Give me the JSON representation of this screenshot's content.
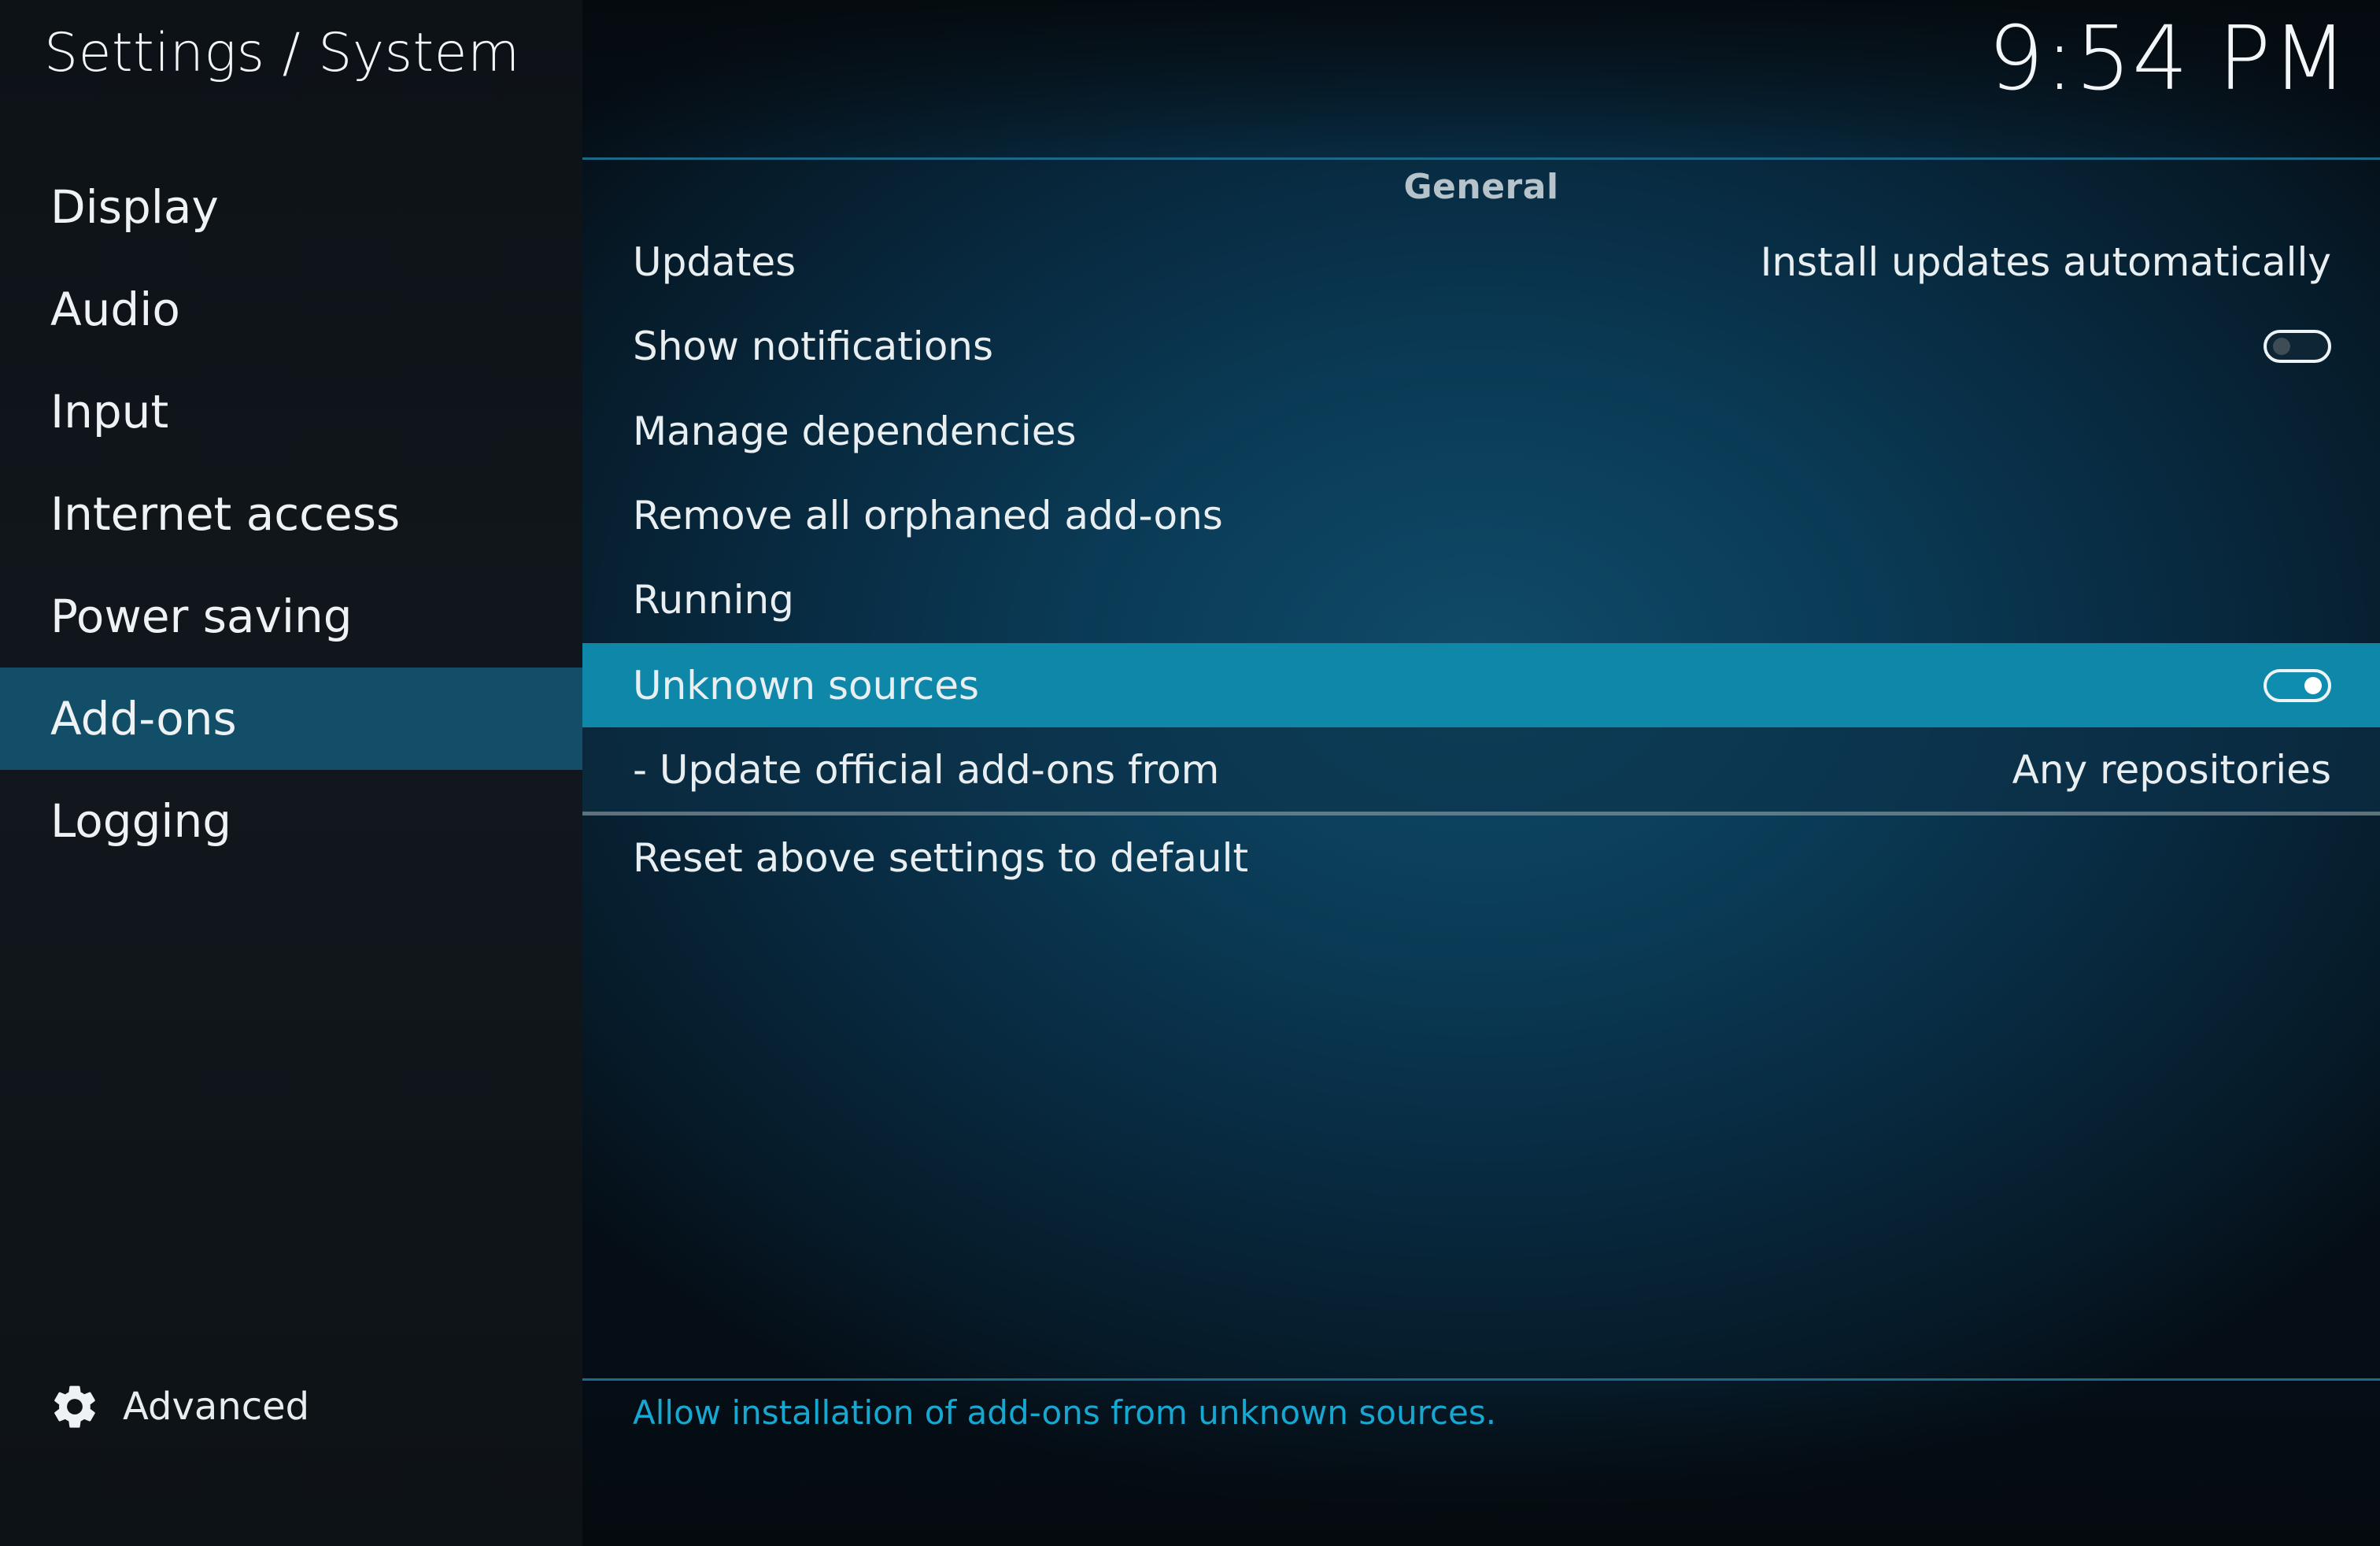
{
  "header": {
    "title": "Settings / System",
    "clock": "9:54 PM"
  },
  "sidebar": {
    "items": [
      {
        "label": "Display",
        "active": false
      },
      {
        "label": "Audio",
        "active": false
      },
      {
        "label": "Input",
        "active": false
      },
      {
        "label": "Internet access",
        "active": false
      },
      {
        "label": "Power saving",
        "active": false
      },
      {
        "label": "Add-ons",
        "active": true
      },
      {
        "label": "Logging",
        "active": false
      }
    ],
    "settings_level": {
      "label": "Advanced",
      "icon": "gear-icon"
    }
  },
  "main": {
    "section_header": "General",
    "settings": [
      {
        "label": "Updates",
        "value": "Install updates automatically"
      },
      {
        "label": "Show notifications",
        "toggle": false
      },
      {
        "label": "Manage dependencies"
      },
      {
        "label": "Remove all orphaned add-ons"
      },
      {
        "label": "Running"
      },
      {
        "label": "Unknown sources",
        "toggle": true,
        "focused": true
      },
      {
        "label": "- Update official add-ons from",
        "value": "Any repositories"
      },
      {
        "label": "Reset above settings to default"
      }
    ]
  },
  "help": {
    "text": "Allow installation of add-ons from unknown sources."
  },
  "colors": {
    "accent": "#0e87a8",
    "active_category": "#134e68",
    "help_text": "#17a7d0"
  }
}
